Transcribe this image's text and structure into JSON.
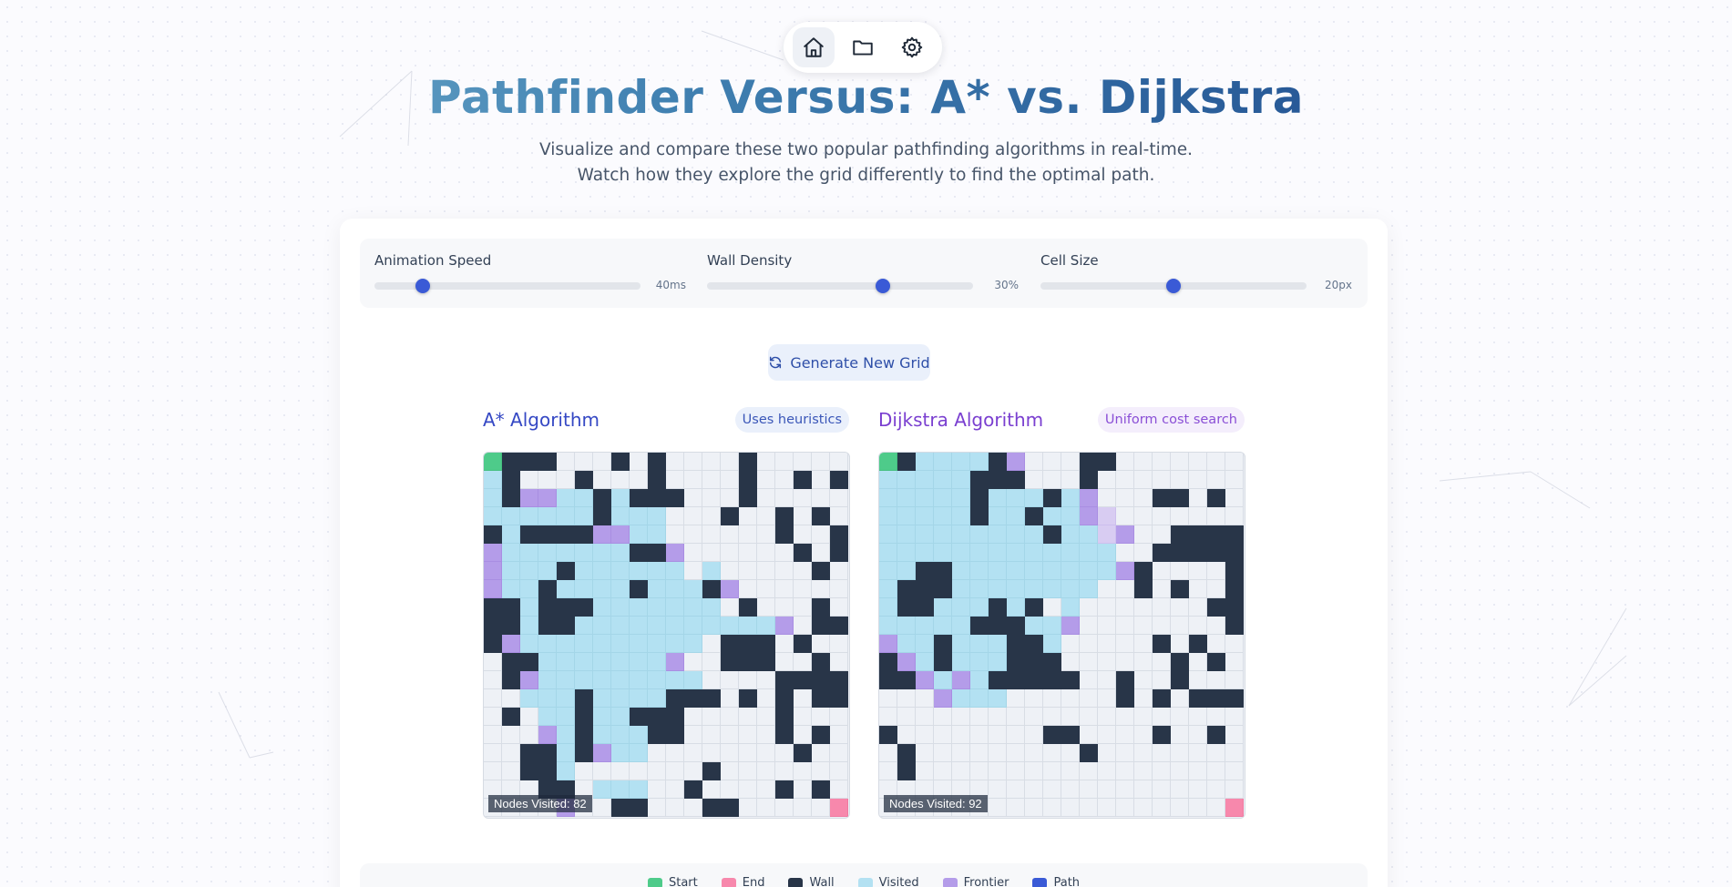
{
  "nav": {
    "items": [
      {
        "name": "home",
        "icon": "home-icon",
        "active": true
      },
      {
        "name": "projects",
        "icon": "folder-icon",
        "active": false
      },
      {
        "name": "settings",
        "icon": "gear-icon",
        "active": false
      }
    ]
  },
  "header": {
    "title": "Pathfinder Versus: A* vs. Dijkstra",
    "subtitle_line1": "Visualize and compare these two popular pathfinding algorithms in real-time.",
    "subtitle_line2": "Watch how they explore the grid differently to find the optimal path."
  },
  "controls": {
    "speed": {
      "label": "Animation Speed",
      "value_text": "40ms",
      "fraction": 0.18
    },
    "density": {
      "label": "Wall Density",
      "value_text": "30%",
      "fraction": 0.66
    },
    "cell_size": {
      "label": "Cell Size",
      "value_text": "20px",
      "fraction": 0.5
    }
  },
  "generate_button": {
    "label": "Generate New Grid",
    "icon": "refresh-icon"
  },
  "colors": {
    "accent": "#3a5ad6",
    "astar_title": "#3548c4",
    "dijkstra_title": "#7a3fd0",
    "start": "#4ecb8a",
    "end": "#f788ac",
    "wall": "#283548",
    "visited": "#b3e1f2",
    "frontier": "#b49ce9",
    "path": "#3a5ad6",
    "empty": "#eef1f6"
  },
  "astar": {
    "title": "A* Algorithm",
    "badge": "Uses heuristics",
    "nodes_visited": "Nodes Visited: 82",
    "grid": [
      "SWWWEEEWEWEEEEWEEEEE",
      "VWEEEWEEEWEEEEWEEWEW",
      "VWFFVVWVWWWEEEWEEEEE",
      "VVVVVVWVVVEEEWEEWEWE",
      "WVWWWWFFVVEEEEEEWEEW",
      "FVVVVVVVWWFEEEEEEWEW",
      "FVVVWVVVVVVEVEEEEEWE",
      "FVVWVVVVWVVVWFEEEEEE",
      "WWVWWWVVVVVVVEWEEEWE",
      "WWVWWVVVVVVVVVVVFEWW",
      "WFVVVVVVVVVVEWWWEWEE",
      "EWWVVVVVVVFEEWWWEEWE",
      "EWFVVVVVVVVVEEEEWWWW",
      "EEVVVWVVVVWWWEWEWEWW",
      "EWEVVWVVWWWEEEEEWEEE",
      "EEEFVWVVVWWEEEEEWEWE",
      "EEWWVWFVVEEEEEEEEWEE",
      "EEWWVEEEEEEEWEEEEEEE",
      "EEEWWEVVVEEWEEEEWEWE",
      "EEEEFEEWWEEEWWEEEEEG"
    ]
  },
  "dijkstra": {
    "title": "Dijkstra Algorithm",
    "badge": "Uniform cost search",
    "nodes_visited": "Nodes Visited: 92",
    "grid": [
      "SWVVVVWFEEEWWEEEEEEE",
      "VVVVVWWWEEEWEEEEEEEE",
      "VVVVVWVVVWVFEEEWWEWE",
      "VVVVVWVVWVVFLEEEEEEE",
      "VVVVVVVVVWVVLFEEWWWW",
      "VVVVVVVVVVVVVEEWWWWW",
      "VVWWVVVVVVVVVFWEEEEW",
      "VWWWVVVVVVVVEEWEWEEW",
      "VWWVVVWVWEVEEEEEEEWW",
      "VVVVVWWWVVFEEEEEEEEW",
      "FVVWVVVWWVEEEEEWEWEE",
      "WFVWVVVWWWEEEEEEWEWE",
      "WWFVFVWWWWWEEWEEWEEE",
      "EEEFVVVEEEEEEWEWEWWW",
      "EEEEEEEEEEEEEEEEEEEE",
      "WEEEEEEEEWWEEEEWEEWE",
      "EWEEEEEEEEEWEEEEEEEE",
      "EWEEEEEEEEEEEEEEEEEE",
      "EEEEEEEEEEEEEEEEEEEE",
      "EEEEEEEEEEEEEEEEEEEG"
    ]
  },
  "legend": {
    "items": [
      {
        "label": "Start",
        "color": "#4ecb8a"
      },
      {
        "label": "End",
        "color": "#f788ac"
      },
      {
        "label": "Wall",
        "color": "#283548"
      },
      {
        "label": "Visited",
        "color": "#b3e1f2"
      },
      {
        "label": "Frontier",
        "color": "#b49ce9"
      },
      {
        "label": "Path",
        "color": "#3a5ad6"
      }
    ]
  }
}
